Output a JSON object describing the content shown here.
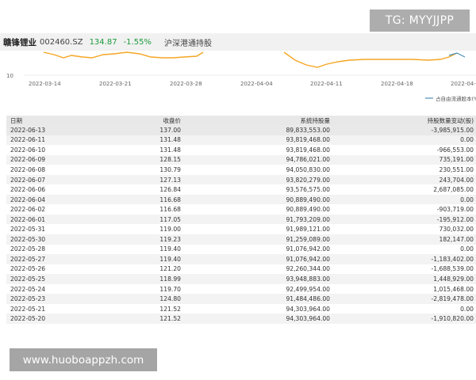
{
  "header": {
    "name": "赣锋锂业",
    "code": "002460.SZ",
    "price": "134.87",
    "change": "-1.55%",
    "tag": "沪深港通持股"
  },
  "chart": {
    "y_tick": "10",
    "x_ticks": [
      "2022-03-14",
      "2022-03-21",
      "2022-03-28",
      "2022-04-04",
      "2022-04-11",
      "2022-04-18",
      "2022-04-"
    ],
    "legend": "占自由流通股本(%)",
    "colors": {
      "line": "#f5a623",
      "legend_line": "#4a90b8"
    }
  },
  "table": {
    "headers": [
      "日期",
      "收盘价",
      "系统持股量",
      "持股数量变动(股)"
    ],
    "rows": [
      [
        "2022-06-13",
        "137.00",
        "89,833,553.00",
        "-3,985,915.00"
      ],
      [
        "2022-06-11",
        "131.48",
        "93,819,468.00",
        "0.00"
      ],
      [
        "2022-06-10",
        "131.48",
        "93,819,468.00",
        "-966,553.00"
      ],
      [
        "2022-06-09",
        "128.15",
        "94,786,021.00",
        "735,191.00"
      ],
      [
        "2022-06-08",
        "130.79",
        "94,050,830.00",
        "230,551.00"
      ],
      [
        "2022-06-07",
        "127.13",
        "93,820,279.00",
        "243,704.00"
      ],
      [
        "2022-06-06",
        "126.84",
        "93,576,575.00",
        "2,687,085.00"
      ],
      [
        "2022-06-04",
        "116.68",
        "90,889,490.00",
        "0.00"
      ],
      [
        "2022-06-02",
        "116.68",
        "90,889,490.00",
        "-903,719.00"
      ],
      [
        "2022-06-01",
        "117.05",
        "91,793,209.00",
        "-195,912.00"
      ],
      [
        "2022-05-31",
        "119.00",
        "91,989,121.00",
        "730,032.00"
      ],
      [
        "2022-05-30",
        "119.23",
        "91,259,089.00",
        "182,147.00"
      ],
      [
        "2022-05-28",
        "119.40",
        "91,076,942.00",
        "0.00"
      ],
      [
        "2022-05-27",
        "119.40",
        "91,076,942.00",
        "-1,183,402.00"
      ],
      [
        "2022-05-26",
        "121.20",
        "92,260,344.00",
        "-1,688,539.00"
      ],
      [
        "2022-05-25",
        "118.99",
        "93,948,883.00",
        "1,448,929.00"
      ],
      [
        "2022-05-24",
        "119.70",
        "92,499,954.00",
        "1,015,468.00"
      ],
      [
        "2022-05-23",
        "124.80",
        "91,484,486.00",
        "-2,819,478.00"
      ],
      [
        "2022-05-21",
        "121.52",
        "94,303,964.00",
        "0.00"
      ],
      [
        "2022-05-20",
        "121.52",
        "94,303,964.00",
        "-1,910,820.00"
      ]
    ]
  },
  "watermarks": {
    "tg": "TG: MYYJJPP",
    "site": "www.huoboappzh.com"
  }
}
